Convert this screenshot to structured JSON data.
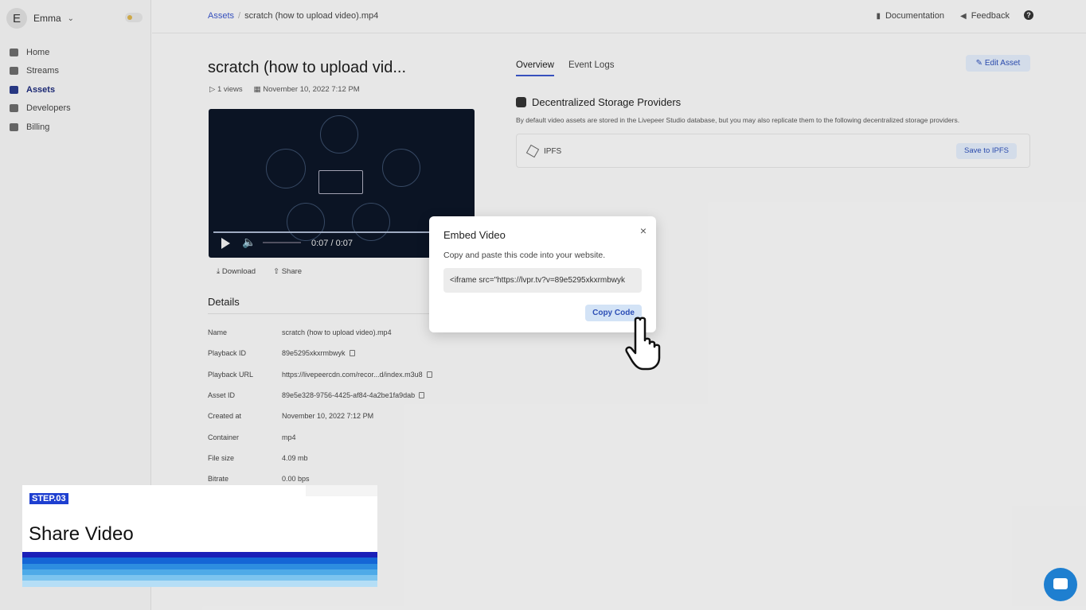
{
  "user": {
    "initial": "E",
    "name": "Emma"
  },
  "sidebar": {
    "items": [
      {
        "label": "Home",
        "active": false
      },
      {
        "label": "Streams",
        "active": false
      },
      {
        "label": "Assets",
        "active": true
      },
      {
        "label": "Developers",
        "active": false
      },
      {
        "label": "Billing",
        "active": false
      }
    ]
  },
  "breadcrumb": {
    "root": "Assets",
    "current": "scratch (how to upload video).mp4"
  },
  "topnav": {
    "documentation": "Documentation",
    "feedback": "Feedback",
    "help": "?"
  },
  "asset": {
    "title": "scratch (how to upload vid...",
    "views": "1 views",
    "date": "November 10, 2022 7:12 PM",
    "time_display": "0:07 / 0:07",
    "download": "Download",
    "share": "Share"
  },
  "details": {
    "heading": "Details",
    "rows": [
      {
        "key": "Name",
        "value": "scratch (how to upload video).mp4"
      },
      {
        "key": "Playback ID",
        "value": "89e5295xkxrmbwyk"
      },
      {
        "key": "Playback URL",
        "value": "https://livepeercdn.com/recor...d/index.m3u8"
      },
      {
        "key": "Asset ID",
        "value": "89e5e328-9756-4425-af84-4a2be1fa9dab"
      },
      {
        "key": "Created at",
        "value": "November 10, 2022 7:12 PM"
      },
      {
        "key": "Container",
        "value": "mp4"
      },
      {
        "key": "File size",
        "value": "4.09 mb"
      },
      {
        "key": "Bitrate",
        "value": "0.00 bps"
      }
    ]
  },
  "tabs": {
    "overview": "Overview",
    "event_logs": "Event Logs"
  },
  "edit_asset": "Edit Asset",
  "storage": {
    "title": "Decentralized Storage Providers",
    "description": "By default video assets are stored in the Livepeer Studio database, but you may also replicate them to the following decentralized storage providers.",
    "provider": "IPFS",
    "save_label": "Save to IPFS"
  },
  "modal": {
    "title": "Embed Video",
    "description": "Copy and paste this code into your website.",
    "code": "<iframe src=\"https://lvpr.tv?v=89e5295xkxrmbwyk",
    "copy_label": "Copy Code",
    "close": "×"
  },
  "step": {
    "tag": "STEP.03",
    "title": "Share Video"
  },
  "colors": {
    "accent": "#3a56c8",
    "stripes": [
      "#1a1fb8",
      "#1466d6",
      "#2d8de0",
      "#4eaae8",
      "#7cc4ef",
      "#b5def6"
    ]
  }
}
